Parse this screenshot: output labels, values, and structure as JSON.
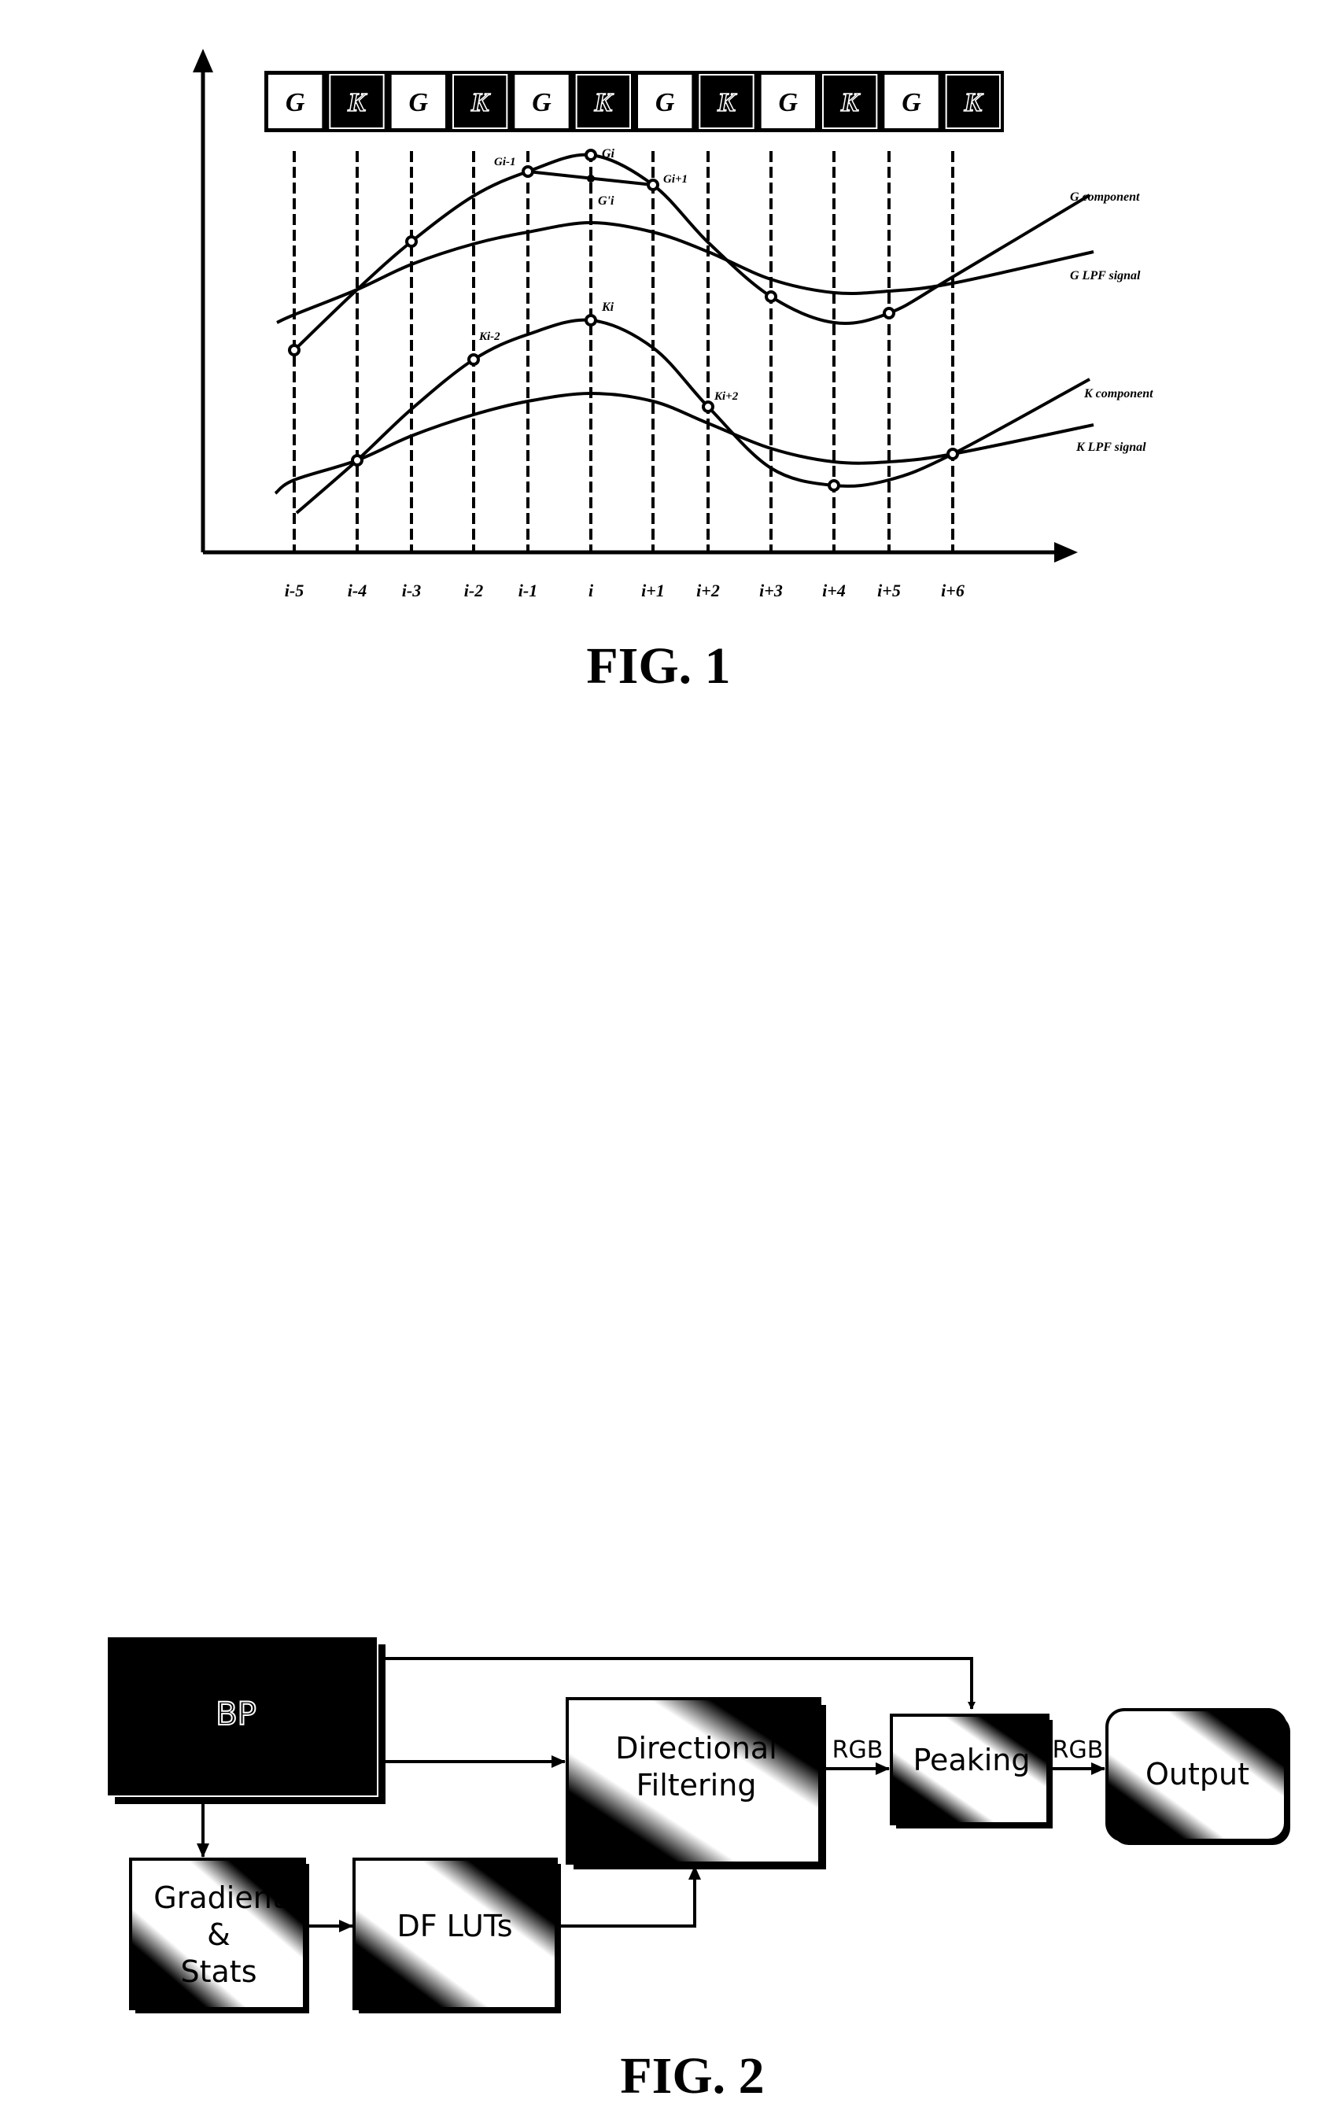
{
  "fig1": {
    "caption": "FIG. 1",
    "pattern": [
      "G",
      "K",
      "G",
      "K",
      "G",
      "K",
      "G",
      "K",
      "G",
      "K",
      "G",
      "K"
    ],
    "x_ticks": [
      "i-5",
      "i-4",
      "i-3",
      "i-2",
      "i-1",
      "i",
      "i+1",
      "i+2",
      "i+3",
      "i+4",
      "i+5",
      "i+6"
    ],
    "legend": {
      "g_component": "G component",
      "g_lpf": "G LPF signal",
      "k_component": "K component",
      "k_lpf": "K LPF signal"
    },
    "point_labels": {
      "g_im1": "Gi-1",
      "g_i": "Gi",
      "g_ip1": "Gi+1",
      "g_prime_i": "G'i",
      "k_im2": "Ki-2",
      "k_i": "Ki",
      "k_ip2": "Ki+2"
    }
  },
  "chart_data": {
    "type": "line",
    "title": "FIG. 1",
    "x": [
      "i-5",
      "i-4",
      "i-3",
      "i-2",
      "i-1",
      "i",
      "i+1",
      "i+2",
      "i+3",
      "i+4",
      "i+5",
      "i+6"
    ],
    "xlabel": "",
    "ylabel": "",
    "grid": "vertical dashed lines at each sample",
    "series": [
      {
        "name": "G component",
        "values": [
          4.6,
          6.3,
          7.7,
          9.0,
          9.7,
          10.2,
          9.6,
          8.0,
          6.6,
          6.2,
          6.3,
          7.6
        ]
      },
      {
        "name": "G LPF signal",
        "values": [
          5.4,
          6.3,
          7.0,
          7.6,
          7.9,
          8.2,
          7.9,
          7.4,
          7.1,
          6.7,
          6.8,
          7.0
        ]
      },
      {
        "name": "K component",
        "values": [
          1.2,
          2.6,
          4.1,
          5.5,
          6.3,
          6.7,
          5.8,
          4.1,
          2.5,
          1.8,
          2.0,
          2.7
        ]
      },
      {
        "name": "K LPF signal",
        "values": [
          1.8,
          2.6,
          3.3,
          3.9,
          4.3,
          4.5,
          4.3,
          3.6,
          3.0,
          2.6,
          2.6,
          2.7
        ]
      }
    ],
    "sampled_points": {
      "G": [
        "i-5",
        "i-3",
        "i-1",
        "i",
        "i+1",
        "i+3",
        "i+5"
      ],
      "K": [
        "i-4",
        "i-2",
        "i",
        "i+2",
        "i+4",
        "i+6"
      ]
    },
    "interpolated": {
      "name": "G'i",
      "x": "i",
      "value": 9.3
    }
  },
  "fig2": {
    "caption": "FIG. 2",
    "blocks": {
      "bp": "BP",
      "directional_filtering": [
        "Directional",
        "Filtering"
      ],
      "peaking": "Peaking",
      "output": "Output",
      "gradient_stats": [
        "Gradient",
        "&",
        "Stats"
      ],
      "df_luts": "DF LUTs"
    },
    "edge_labels": {
      "df_to_peaking": "RGB",
      "peaking_to_output": "RGB"
    }
  }
}
